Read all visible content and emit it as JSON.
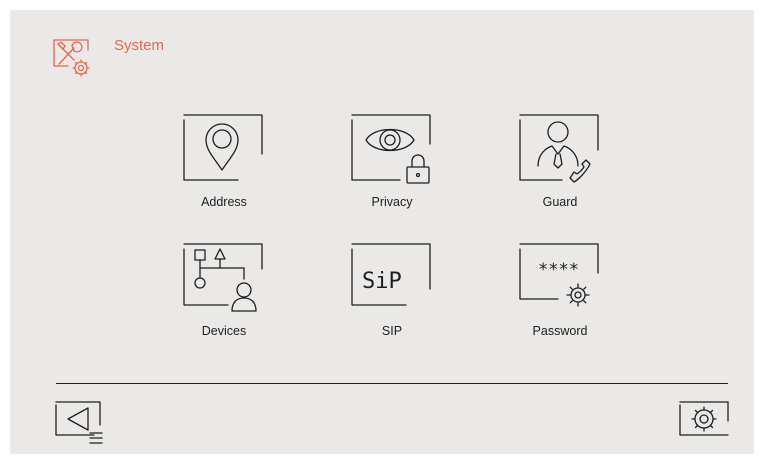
{
  "header": {
    "title": "System",
    "icon": "tools-gear-icon",
    "accent_color": "#e8664c"
  },
  "tiles": [
    {
      "label": "Address",
      "icon": "location-pin-icon"
    },
    {
      "label": "Privacy",
      "icon": "eye-lock-icon"
    },
    {
      "label": "Guard",
      "icon": "guard-phone-icon"
    },
    {
      "label": "Devices",
      "icon": "device-tree-icon"
    },
    {
      "label": "SIP",
      "icon": "sip-icon",
      "icon_text": "SiP"
    },
    {
      "label": "Password",
      "icon": "password-gear-icon",
      "icon_text": "****"
    }
  ],
  "footer": {
    "back_icon": "back-menu-icon",
    "settings_icon": "settings-refresh-icon"
  }
}
